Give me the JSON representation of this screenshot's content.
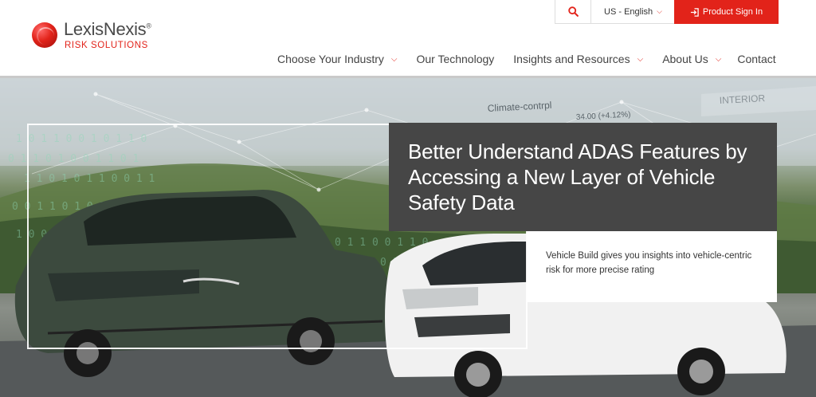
{
  "brand": {
    "name": "LexisNexis",
    "registered": "®",
    "subline": "RISK SOLUTIONS"
  },
  "utility": {
    "search_icon": "search-icon",
    "language": "US - English",
    "signin_label": "Product Sign In",
    "signin_icon": "sign-in-icon"
  },
  "nav": {
    "items": [
      {
        "label": "Choose Your Industry",
        "has_dropdown": true
      },
      {
        "label": "Our Technology",
        "has_dropdown": false
      },
      {
        "label": "Insights and Resources",
        "has_dropdown": true
      },
      {
        "label": "About Us",
        "has_dropdown": true
      },
      {
        "label": "Contact",
        "has_dropdown": false
      }
    ]
  },
  "hero": {
    "headline": "Better Understand ADAS Features by Accessing a New Layer of Vehicle Safety Data",
    "subtext": "Vehicle Build gives you insights into vehicle-centric risk for more precise rating",
    "overlay": {
      "climate": "Climate-contrpl",
      "value": "34.00 (+4.12%)",
      "interior": "INTERIOR"
    }
  },
  "colors": {
    "brand_red": "#e2231a",
    "headline_bg": "#464646"
  }
}
